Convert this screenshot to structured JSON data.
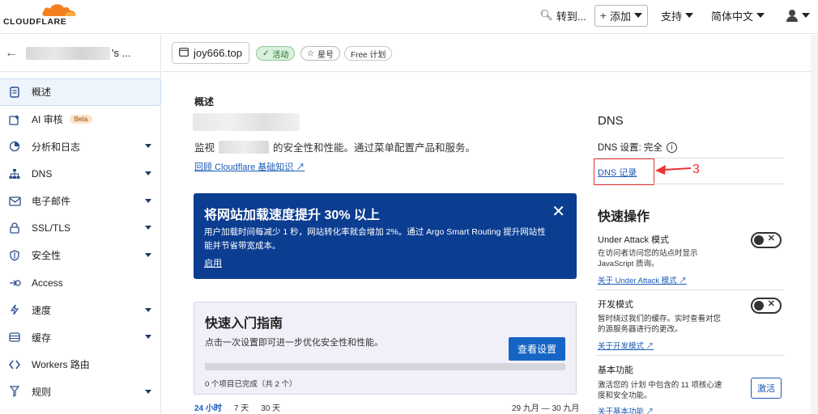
{
  "brand": {
    "name": "CLOUDFLARE",
    "accent": "#f38020"
  },
  "topbar": {
    "goto_label": "转到...",
    "add_label": "添加",
    "support_label": "支持",
    "language_label": "简体中文"
  },
  "sidebar": {
    "account_suffix": "'s ...",
    "items": [
      {
        "label": "概述",
        "icon": "document-icon",
        "has_caret": false
      },
      {
        "label": "AI 审核",
        "icon": "ai-audit-icon",
        "badge": "Beta",
        "has_caret": false
      },
      {
        "label": "分析和日志",
        "icon": "analytics-icon",
        "has_caret": true
      },
      {
        "label": "DNS",
        "icon": "network-icon",
        "has_caret": true
      },
      {
        "label": "电子邮件",
        "icon": "email-icon",
        "has_caret": true
      },
      {
        "label": "SSL/TLS",
        "icon": "lock-icon",
        "has_caret": true
      },
      {
        "label": "安全性",
        "icon": "shield-icon",
        "has_caret": true
      },
      {
        "label": "Access",
        "icon": "access-icon",
        "has_caret": false
      },
      {
        "label": "速度",
        "icon": "bolt-icon",
        "has_caret": true
      },
      {
        "label": "缓存",
        "icon": "cache-icon",
        "has_caret": true
      },
      {
        "label": "Workers 路由",
        "icon": "workers-icon",
        "has_caret": false
      },
      {
        "label": "规则",
        "icon": "rules-icon",
        "has_caret": true
      }
    ]
  },
  "zone": {
    "domain": "joy666.top",
    "status": "活动",
    "star_label": "星号",
    "plan": "Free 计划"
  },
  "overview": {
    "label": "概述",
    "intro_prefix": "监视",
    "intro_suffix": "的安全性和性能。通过菜单配置产品和服务。",
    "review_link": "回顾 Cloudflare 基础知识"
  },
  "promo": {
    "title": "将网站加载速度提升 30% 以上",
    "body": "用户加载时间每减少 1 秒，网站转化率就会增加 2%。通过 Argo Smart Routing 提升网站性能并节省带宽成本。",
    "link": "启用"
  },
  "guide": {
    "title": "快速入门指南",
    "subtitle": "点击一次设置即可进一步优化安全性和性能。",
    "button": "查看设置",
    "progress": 0,
    "count": "0 个项目已完成（共 2 个）"
  },
  "time": {
    "tabs": [
      "24 小时",
      "7 天",
      "30 天"
    ],
    "selected": "24 小时",
    "range": "29 九月 — 30 九月"
  },
  "dns": {
    "heading": "DNS",
    "setting": "DNS 设置: 完全",
    "records_link": "DNS 记录",
    "annotation": "3"
  },
  "quick_actions": {
    "heading": "快速操作",
    "under_attack": {
      "title": "Under Attack 模式",
      "desc": "在访问者访问您的站点时显示 JavaScript 质询。",
      "link": "关于 Under Attack 模式"
    },
    "dev_mode": {
      "title": "开发模式",
      "desc": "暂时绕过我们的缓存。实时查看对您的源服务器进行的更改。",
      "link": "关于开发模式"
    },
    "basic": {
      "title": "基本功能",
      "desc": "激活您的 计划 中包含的 11 项核心速度和安全功能。",
      "button": "激活",
      "link": "关于基本功能"
    }
  }
}
